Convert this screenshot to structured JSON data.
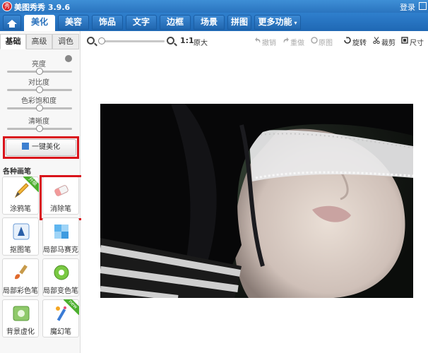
{
  "app": {
    "title": "美图秀秀 3.9.6",
    "logo": "秀",
    "login": "登录"
  },
  "menu": {
    "tabs": [
      {
        "label": "美化",
        "active": true
      },
      {
        "label": "美容"
      },
      {
        "label": "饰品"
      },
      {
        "label": "文字"
      },
      {
        "label": "边框"
      },
      {
        "label": "场景"
      },
      {
        "label": "拼图"
      }
    ],
    "more": "更多功能",
    "more_arrow": "▾"
  },
  "left": {
    "subtabs": [
      "基础",
      "高级",
      "调色"
    ],
    "sliders": [
      {
        "label": "亮度",
        "value": 0.5
      },
      {
        "label": "对比度",
        "value": 0.5
      },
      {
        "label": "色彩饱和度",
        "value": 0.5
      },
      {
        "label": "清晰度",
        "value": 0.5
      }
    ],
    "one_key": "一键美化",
    "section_title": "各种画笔",
    "tools": [
      {
        "label": "涂鸦笔",
        "icon": "pencil-icon",
        "badge": "升级"
      },
      {
        "label": "消除笔",
        "icon": "eraser-icon"
      },
      {
        "label": "抠图笔",
        "icon": "pen-nib-icon"
      },
      {
        "label": "局部马赛克",
        "icon": "mosaic-icon"
      },
      {
        "label": "局部彩色笔",
        "icon": "color-brush-icon"
      },
      {
        "label": "局部变色笔",
        "icon": "color-change-icon"
      },
      {
        "label": "背景虚化",
        "icon": "blur-icon"
      },
      {
        "label": "魔幻笔",
        "icon": "magic-wand-icon",
        "badge": "new"
      }
    ]
  },
  "toolbar": {
    "ratio": "1:1",
    "original_size": "原大",
    "undo": "撤销",
    "redo": "重做",
    "original": "原图",
    "rotate": "旋转",
    "crop": "裁剪",
    "size": "尺寸"
  },
  "colors": {
    "accent_blue": "#2a72bd",
    "highlight_red": "#d9131b",
    "badge_green": "#4caf2e"
  }
}
